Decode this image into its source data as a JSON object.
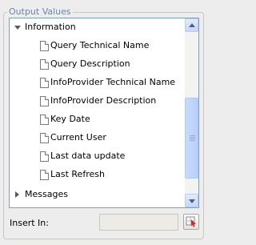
{
  "group": {
    "title": "Output Values"
  },
  "tree": {
    "information": {
      "label": "Information",
      "expanded": true,
      "children": [
        "Query Technical Name",
        "Query Description",
        "InfoProvider Technical Name",
        "InfoProvider Description",
        "Key Date",
        "Current User",
        "Last data update",
        "Last Refresh"
      ]
    },
    "messages": {
      "label": "Messages",
      "expanded": false
    }
  },
  "insert": {
    "label": "Insert In:",
    "value": ""
  },
  "colors": {
    "legend": "#6b84ae",
    "panel_border": "#7f9db9",
    "scrollbar": "#c4d6fb"
  },
  "icons": {
    "expanded": "triangle-down-icon",
    "collapsed": "triangle-right-icon",
    "item": "document-icon",
    "pick": "select-cell-icon"
  }
}
